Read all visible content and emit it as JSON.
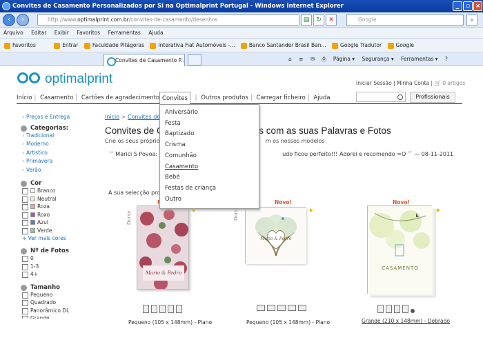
{
  "window": {
    "title": "Convites de Casamento Personalizados por Si na Optimalprint Portugal - Windows Internet Explorer"
  },
  "address": {
    "url_prefix": "http://www.",
    "url_host": "optimalprint.com.br",
    "url_path": "/convites-de-casamento/desenhos",
    "search_placeholder": "Google"
  },
  "menubar": [
    "Arquivo",
    "Editar",
    "Exibir",
    "Favoritos",
    "Ferramentas",
    "Ajuda"
  ],
  "favorites": {
    "label": "Favoritos",
    "items": [
      "Entrar",
      "Faculdade Pitágoras",
      "Interativa Fiat Automóveis -...",
      "Banco Santander Brasil Ban...",
      "Google Tradutor",
      "Google"
    ]
  },
  "tab": {
    "label": "Convites de Casamento P...",
    "tools": [
      "Página ▾",
      "Segurança ▾",
      "Ferramentas ▾"
    ]
  },
  "site": {
    "logo": "optimalprint",
    "toplinks": "Iniciar Sessão | Minha Conta |",
    "cart": "0 artigos",
    "nav": [
      "Início",
      "Casamento",
      "Cartões de agradecimento",
      "Convites",
      "Outros produtos",
      "Carregar ficheiro",
      "Ajuda"
    ],
    "profissionais": "Profissionais"
  },
  "dropdown": [
    "Aniversário",
    "Festa",
    "Baptizado",
    "Crisma",
    "Comunhão",
    "Casamento",
    "Bebé",
    "Festas de criança",
    "Outro"
  ],
  "sidebar": {
    "precos": "Preços e Entrega",
    "categorias_label": "Categorias:",
    "categorias": [
      "Tradicional",
      "Moderno",
      "Artístico",
      "Primavera",
      "Verão"
    ],
    "cor_label": "Cor",
    "cores": [
      {
        "name": "Branco",
        "color": "#ffffff"
      },
      {
        "name": "Neutral",
        "color": "#f3ead8"
      },
      {
        "name": "Roza",
        "color": "#f2a0b8"
      },
      {
        "name": "Roxo",
        "color": "#9a5ab0"
      },
      {
        "name": "Azul",
        "color": "#5a7ad0"
      },
      {
        "name": "Verde",
        "color": "#8ad070"
      }
    ],
    "mais_cores": "+ Ver mais cores",
    "fotos_label": "Nº de Fotos",
    "fotos": [
      "0",
      "1-3",
      "4+"
    ],
    "tamanho_label": "Tamanho",
    "tamanhos": [
      "Pequeno",
      "Quadrado",
      "Panorâmico DL",
      "Grande"
    ]
  },
  "main": {
    "breadcrumb_home": "Início",
    "breadcrumb_sep": ">",
    "breadcrumb_cur": "Convites de C",
    "title_left": "Convites de C",
    "title_right": "os com as suas Palavras e Fotos",
    "sub_left": "Crie os seus próprios",
    "sub_right": "m os nossos modelos",
    "quote_author": "Marici S Povoa:",
    "quote_text": "udo ficou perfeito!!! Adorei e recomendo =O",
    "quote_date": "— 08-11-2011",
    "selection": "A sua selecção prod",
    "dorso": "Dorso",
    "novo": "Novo!",
    "cards": [
      {
        "caption": "Pequeno (105 x 148mm) - Plano",
        "text": "Mario & Pedro"
      },
      {
        "caption": "Pequeno (105 x 148mm) - Plano",
        "text": "Mario & Pedro"
      },
      {
        "caption": "Grande (210 x 148mm) - Dobrado",
        "text": "CASAMENTO"
      }
    ]
  }
}
